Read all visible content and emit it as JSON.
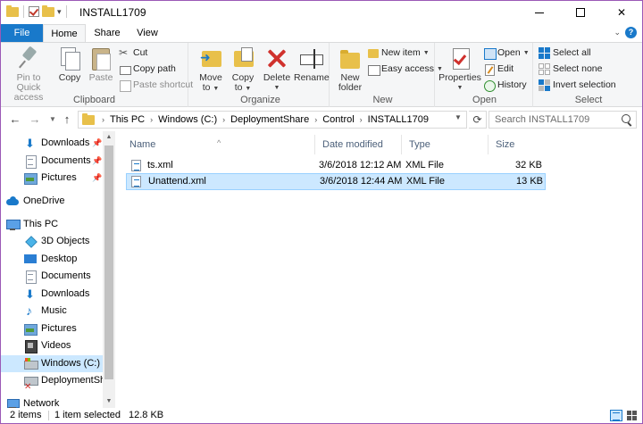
{
  "window": {
    "title": "INSTALL1709"
  },
  "tabs": {
    "file": "File",
    "home": "Home",
    "share": "Share",
    "view": "View"
  },
  "ribbon": {
    "clipboard": {
      "label": "Clipboard",
      "pin_line1": "Pin to Quick",
      "pin_line2": "access",
      "copy": "Copy",
      "paste": "Paste",
      "cut": "Cut",
      "copy_path": "Copy path",
      "paste_shortcut": "Paste shortcut"
    },
    "organize": {
      "label": "Organize",
      "move_line1": "Move",
      "move_line2": "to",
      "copy_line1": "Copy",
      "copy_line2": "to",
      "delete": "Delete",
      "rename": "Rename"
    },
    "new": {
      "label": "New",
      "folder_line1": "New",
      "folder_line2": "folder",
      "new_item": "New item",
      "easy_access": "Easy access"
    },
    "open": {
      "label": "Open",
      "properties": "Properties",
      "open": "Open",
      "edit": "Edit",
      "history": "History"
    },
    "select": {
      "label": "Select",
      "select_all": "Select all",
      "select_none": "Select none",
      "invert": "Invert selection"
    }
  },
  "address": {
    "crumbs": [
      "This PC",
      "Windows (C:)",
      "DeploymentShare",
      "Control",
      "INSTALL1709"
    ],
    "search_placeholder": "Search INSTALL1709"
  },
  "nav": {
    "items": [
      {
        "label": "Downloads",
        "icon": "download-icon",
        "pinned": true
      },
      {
        "label": "Documents",
        "icon": "documents-icon",
        "pinned": true
      },
      {
        "label": "Pictures",
        "icon": "pictures-icon",
        "pinned": true
      },
      {
        "label": "OneDrive",
        "icon": "onedrive-icon"
      },
      {
        "label": "This PC",
        "icon": "this-pc-icon"
      },
      {
        "label": "3D Objects",
        "icon": "3d-objects-icon"
      },
      {
        "label": "Desktop",
        "icon": "desktop-icon"
      },
      {
        "label": "Documents",
        "icon": "documents-icon"
      },
      {
        "label": "Downloads",
        "icon": "download-icon"
      },
      {
        "label": "Music",
        "icon": "music-icon"
      },
      {
        "label": "Pictures",
        "icon": "pictures-icon"
      },
      {
        "label": "Videos",
        "icon": "videos-icon"
      },
      {
        "label": "Windows (C:)",
        "icon": "drive-icon",
        "selected": true
      },
      {
        "label": "DeploymentShare",
        "icon": "network-drive-icon"
      },
      {
        "label": "Network",
        "icon": "network-icon"
      }
    ]
  },
  "files": {
    "columns": {
      "name": "Name",
      "date": "Date modified",
      "type": "Type",
      "size": "Size"
    },
    "rows": [
      {
        "name": "ts.xml",
        "date": "3/6/2018 12:12 AM",
        "type": "XML File",
        "size": "32 KB"
      },
      {
        "name": "Unattend.xml",
        "date": "3/6/2018 12:44 AM",
        "type": "XML File",
        "size": "13 KB",
        "selected": true
      }
    ]
  },
  "status": {
    "count": "2 items",
    "selected": "1 item selected",
    "size": "12.8 KB"
  },
  "colors": {
    "accent": "#1979ca",
    "selection": "#cce8ff",
    "window_border": "#9b59b6"
  }
}
